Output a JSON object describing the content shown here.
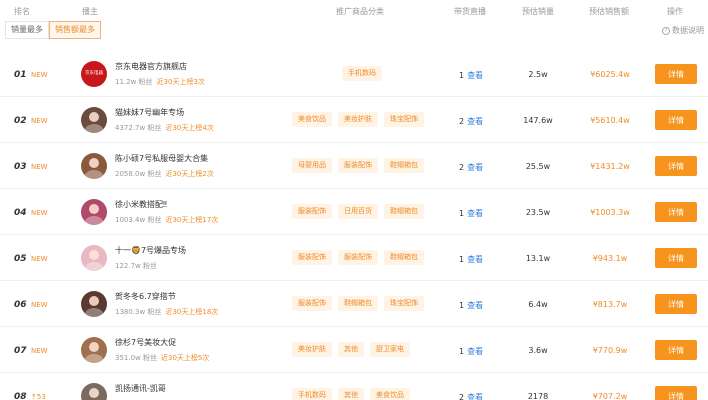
{
  "header": {
    "rank": "排名",
    "streamer": "播主",
    "category": "推广商品分类",
    "live": "带货直播",
    "sales": "预估销量",
    "amount": "预估销售额",
    "action": "操作"
  },
  "tabs": [
    "销量最多",
    "销售额最多"
  ],
  "active_tab": 1,
  "help": {
    "label": "数据说明",
    "icon": "question-circle-icon"
  },
  "colors": {
    "accent": "#f7941d",
    "tag_bg": "#fff3e6",
    "link": "#2f7de1"
  },
  "rows": [
    {
      "rank": "01",
      "badge": "NEW",
      "name": "京东电器官方旗舰店",
      "fans": "11.2w 粉丝",
      "hot": "近30天上榜3次",
      "tags": [
        "手机数码"
      ],
      "live_count": "1",
      "live_link": "查看",
      "sales": "2.5w",
      "amount": "¥6025.4w",
      "action": "详情",
      "avatar_color": "#c8161d",
      "avatar_text": "京东电器"
    },
    {
      "rank": "02",
      "badge": "NEW",
      "name": "猫妹妹7号幽年专场",
      "fans": "4372.7w 粉丝",
      "hot": "近30天上榜4次",
      "tags": [
        "美食饮品",
        "美妆护肤",
        "珠宝配饰"
      ],
      "live_count": "2",
      "live_link": "查看",
      "sales": "147.6w",
      "amount": "¥5610.4w",
      "action": "详情",
      "avatar_color": "#6b4b3e",
      "avatar_text": ""
    },
    {
      "rank": "03",
      "badge": "NEW",
      "name": "陈小硕7号私服母婴大合集",
      "fans": "2058.0w 粉丝",
      "hot": "近30天上榜2次",
      "tags": [
        "母婴用品",
        "服装配饰",
        "鞋帽箱包"
      ],
      "live_count": "2",
      "live_link": "查看",
      "sales": "25.5w",
      "amount": "¥1431.2w",
      "action": "详情",
      "avatar_color": "#8a5a3c",
      "avatar_text": ""
    },
    {
      "rank": "04",
      "badge": "NEW",
      "name": "徐小米教搭配‼",
      "fans": "1003.4w 粉丝",
      "hot": "近30天上榜17次",
      "tags": [
        "服装配饰",
        "日用百货",
        "鞋帽箱包"
      ],
      "live_count": "1",
      "live_link": "查看",
      "sales": "23.5w",
      "amount": "¥1003.3w",
      "action": "详情",
      "avatar_color": "#b04a6a",
      "avatar_text": ""
    },
    {
      "rank": "05",
      "badge": "NEW",
      "name": "十一🦁7号爆品专场",
      "fans": "122.7w 粉丝",
      "hot": "",
      "tags": [
        "服装配饰",
        "服装配饰",
        "鞋帽箱包"
      ],
      "live_count": "1",
      "live_link": "查看",
      "sales": "13.1w",
      "amount": "¥943.1w",
      "action": "详情",
      "avatar_color": "#e8b8c4",
      "avatar_text": ""
    },
    {
      "rank": "06",
      "badge": "NEW",
      "name": "贺冬冬6.7穿搭节",
      "fans": "1380.3w 粉丝",
      "hot": "近30天上榜18次",
      "tags": [
        "服装配饰",
        "鞋帽箱包",
        "珠宝配饰"
      ],
      "live_count": "1",
      "live_link": "查看",
      "sales": "6.4w",
      "amount": "¥813.7w",
      "action": "详情",
      "avatar_color": "#5a3a2e",
      "avatar_text": ""
    },
    {
      "rank": "07",
      "badge": "NEW",
      "name": "徐杉7号美妆大促",
      "fans": "351.0w 粉丝",
      "hot": "近30天上榜5次",
      "tags": [
        "美妆护肤",
        "其他",
        "厨卫家电"
      ],
      "live_count": "1",
      "live_link": "查看",
      "sales": "3.6w",
      "amount": "¥770.9w",
      "action": "详情",
      "avatar_color": "#a0704e",
      "avatar_text": ""
    },
    {
      "rank": "08",
      "badge": "↑53",
      "name": "凯扬通讯-凯哥",
      "fans": "190.2w 粉丝",
      "hot": "近30天上榜3次",
      "tags": [
        "手机数码",
        "其他",
        "美食饮品"
      ],
      "live_count": "2",
      "live_link": "查看",
      "sales": "2178",
      "amount": "¥707.2w",
      "action": "详情",
      "avatar_color": "#7a6a60",
      "avatar_text": ""
    }
  ]
}
